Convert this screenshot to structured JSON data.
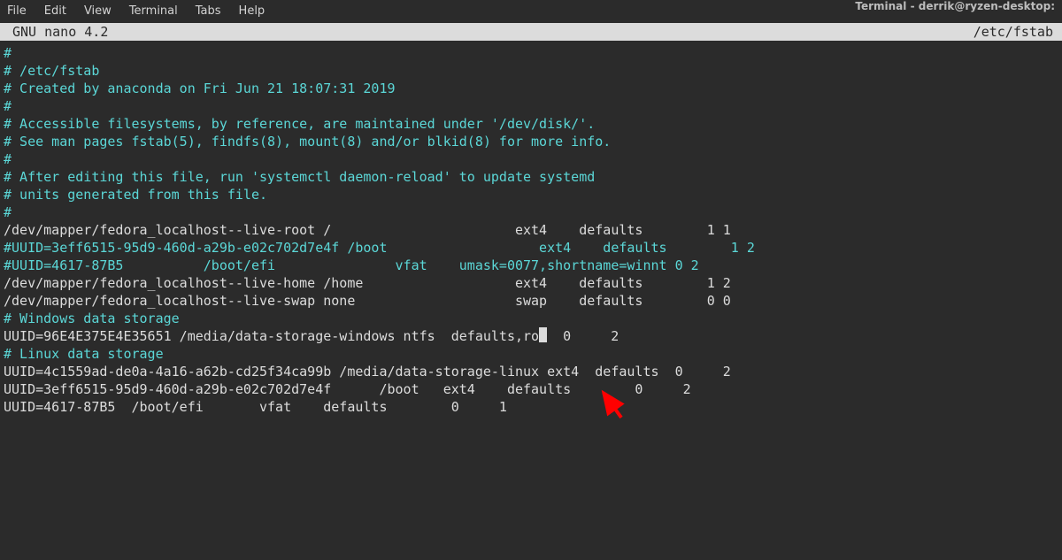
{
  "menu": {
    "items": [
      "File",
      "Edit",
      "View",
      "Terminal",
      "Tabs",
      "Help"
    ]
  },
  "window_title": "Terminal - derrik@ryzen-desktop:",
  "nano": {
    "app": "GNU nano 4.2",
    "filename": "/etc/fstab"
  },
  "lines": [
    {
      "cls": "c-cyan",
      "text": "#"
    },
    {
      "cls": "c-cyan",
      "text": "# /etc/fstab"
    },
    {
      "cls": "c-cyan",
      "text": "# Created by anaconda on Fri Jun 21 18:07:31 2019"
    },
    {
      "cls": "c-cyan",
      "text": "#"
    },
    {
      "cls": "c-cyan",
      "text": "# Accessible filesystems, by reference, are maintained under '/dev/disk/'."
    },
    {
      "cls": "c-cyan",
      "text": "# See man pages fstab(5), findfs(8), mount(8) and/or blkid(8) for more info."
    },
    {
      "cls": "c-cyan",
      "text": "#"
    },
    {
      "cls": "c-cyan",
      "text": "# After editing this file, run 'systemctl daemon-reload' to update systemd"
    },
    {
      "cls": "c-cyan",
      "text": "# units generated from this file."
    },
    {
      "cls": "c-cyan",
      "text": "#"
    },
    {
      "cls": "c-white",
      "text": "/dev/mapper/fedora_localhost--live-root /                       ext4    defaults        1 1"
    },
    {
      "cls": "c-cyan",
      "text": "#UUID=3eff6515-95d9-460d-a29b-e02c702d7e4f /boot                   ext4    defaults        1 2"
    },
    {
      "cls": "c-cyan",
      "text": "#UUID=4617-87B5          /boot/efi               vfat    umask=0077,shortname=winnt 0 2"
    },
    {
      "cls": "c-white",
      "text": "/dev/mapper/fedora_localhost--live-home /home                   ext4    defaults        1 2"
    },
    {
      "cls": "c-white",
      "text": "/dev/mapper/fedora_localhost--live-swap none                    swap    defaults        0 0"
    },
    {
      "cls": "c-white",
      "text": ""
    },
    {
      "cls": "c-cyan",
      "text": "# Windows data storage"
    },
    {
      "cls": "c-white",
      "text": "UUID=96E4E375E4E35651 /media/data-storage-windows ntfs  defaults,ro",
      "cursor": true,
      "after": "  0     2"
    },
    {
      "cls": "c-white",
      "text": ""
    },
    {
      "cls": "c-cyan",
      "text": "# Linux data storage"
    },
    {
      "cls": "c-white",
      "text": "UUID=4c1559ad-de0a-4a16-a62b-cd25f34ca99b /media/data-storage-linux ext4  defaults  0     2"
    },
    {
      "cls": "c-white",
      "text": "UUID=3eff6515-95d9-460d-a29b-e02c702d7e4f      /boot   ext4    defaults        0     2"
    },
    {
      "cls": "c-white",
      "text": "UUID=4617-87B5  /boot/efi       vfat    defaults        0     1"
    }
  ],
  "colors": {
    "cyan": "#5bd7d7",
    "fg": "#dcdcdc",
    "bg": "#2b2b2b",
    "arrow": "#ff0000"
  }
}
